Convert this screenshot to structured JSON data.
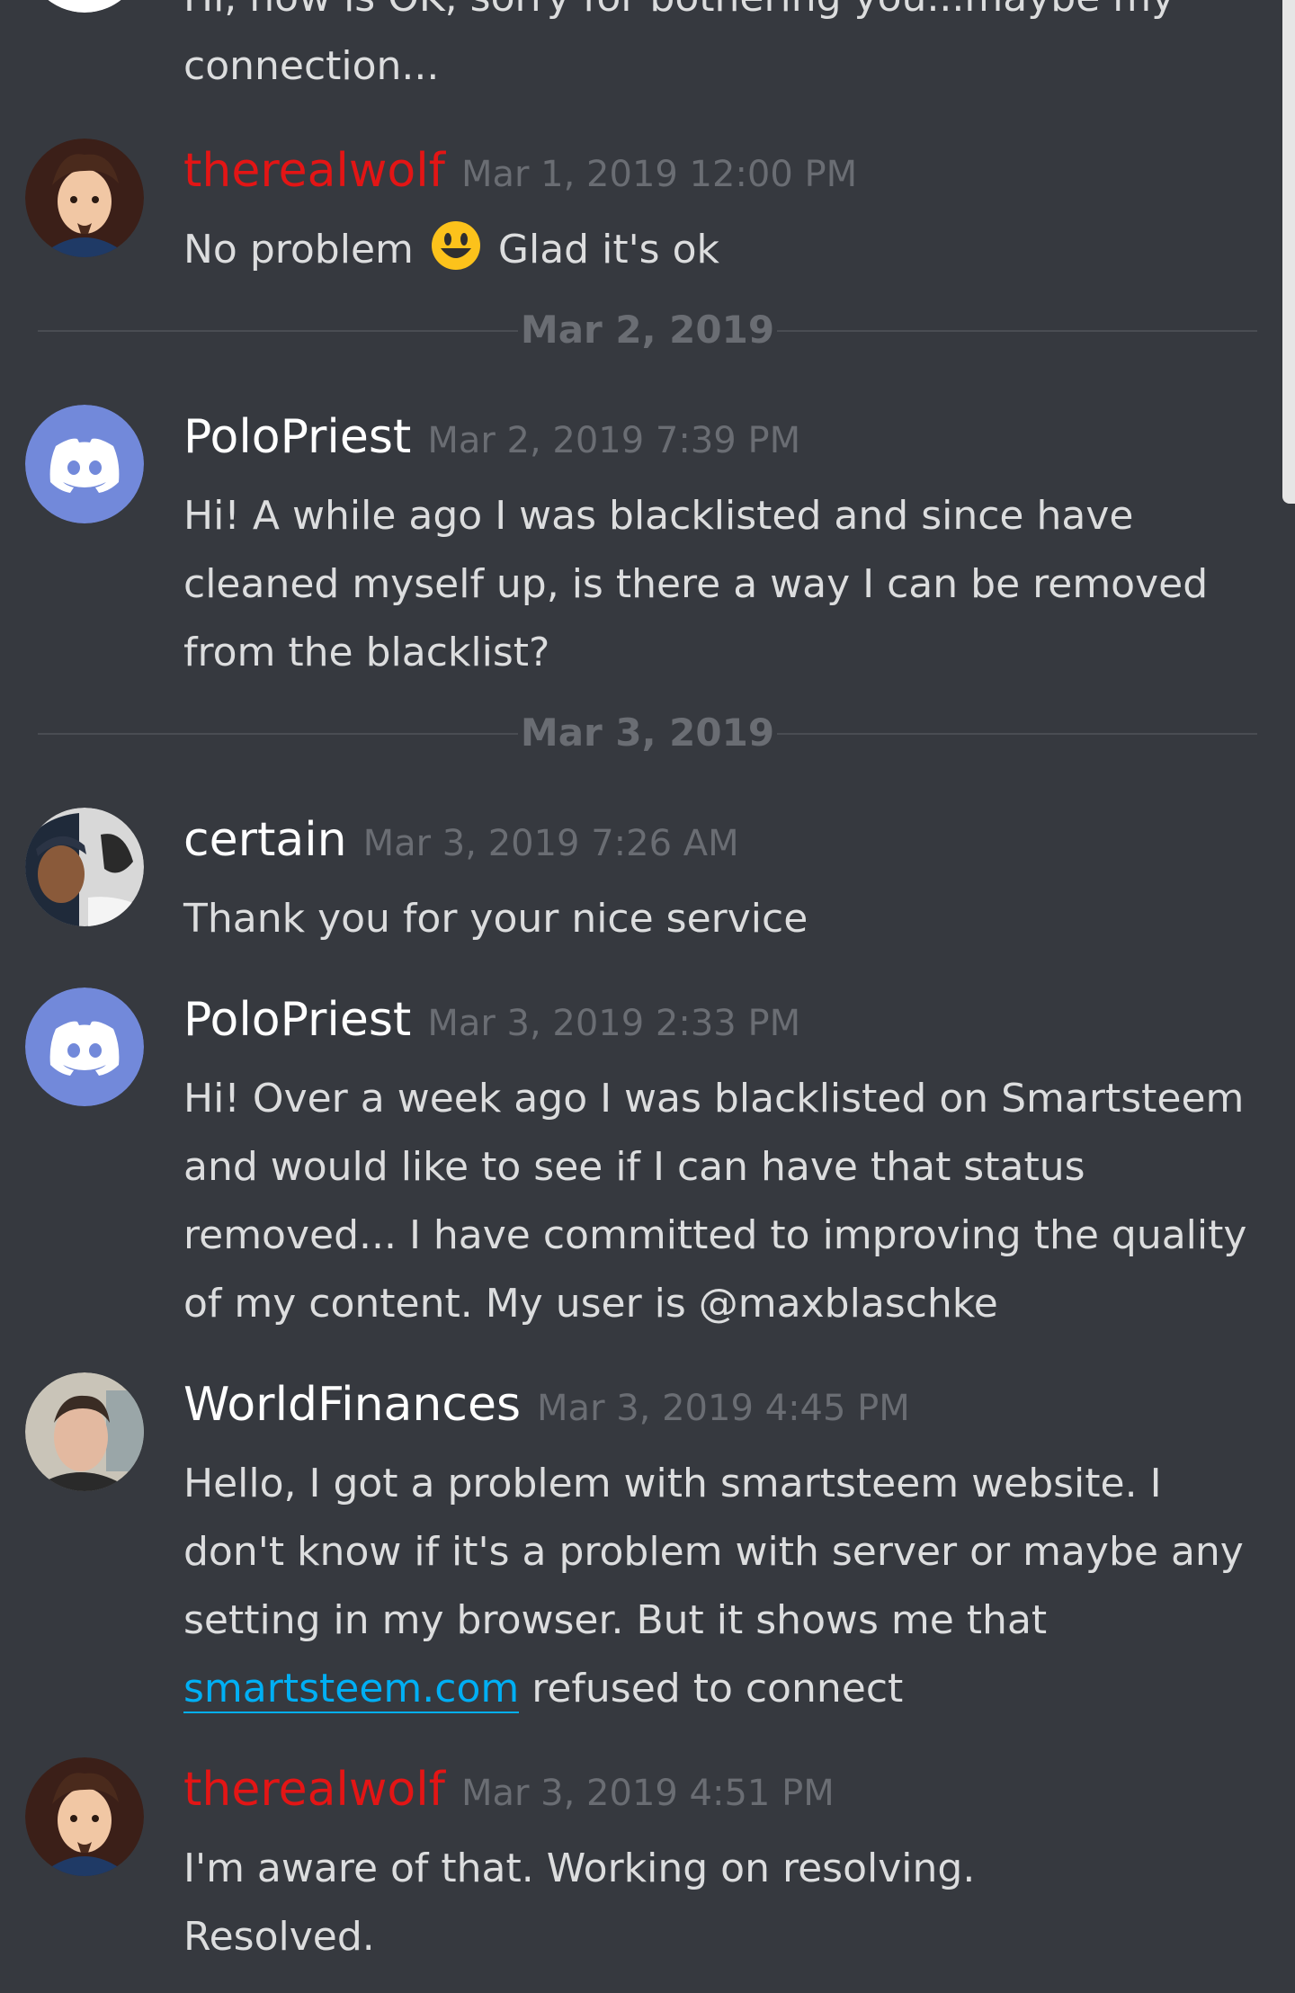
{
  "messages": [
    {
      "continued_text": "Hi, now is OK, sorry for bothering you...maybe my connection..."
    },
    {
      "username": "therealwolf",
      "username_color": "#e31515",
      "timestamp": "Mar 1, 2019 12:00 PM",
      "text_before_emoji": "No problem",
      "emoji": "smiley-emoji",
      "text_after_emoji": "Glad it's ok"
    },
    {
      "divider": "Mar 2, 2019"
    },
    {
      "username": "PoloPriest",
      "timestamp": "Mar 2, 2019 7:39 PM",
      "text": "Hi! A while ago I was blacklisted and since have cleaned myself up, is there a way I can be removed from the blacklist?"
    },
    {
      "divider": "Mar 3, 2019"
    },
    {
      "username": "certain",
      "timestamp": "Mar 3, 2019 7:26 AM",
      "text": "Thank you for your nice service"
    },
    {
      "username": "PoloPriest",
      "timestamp": "Mar 3, 2019 2:33 PM",
      "text": "Hi! Over a week ago I was blacklisted on Smartsteem and would like to see if I can have that status removed... I have committed to improving the quality of my content. My user is @maxblaschke"
    },
    {
      "username": "WorldFinances",
      "timestamp": "Mar 3, 2019 4:45 PM",
      "text_before_link": "Hello,  I got a problem with smartsteem website. I don't know if it's a problem with server or maybe any setting in my browser. But it shows me  that ",
      "link": "smartsteem.com",
      "text_after_link": " refused to connect"
    },
    {
      "username": "therealwolf",
      "username_color": "#e31515",
      "timestamp": "Mar 3, 2019 4:51 PM",
      "line1": "I'm aware of that. Working on resolving.",
      "line2": "Resolved."
    }
  ],
  "colors": {
    "background": "#36393f",
    "text": "#dcddde",
    "timestamp": "#6a6d73",
    "link": "#00aff4",
    "discord_blurple": "#7289da"
  }
}
